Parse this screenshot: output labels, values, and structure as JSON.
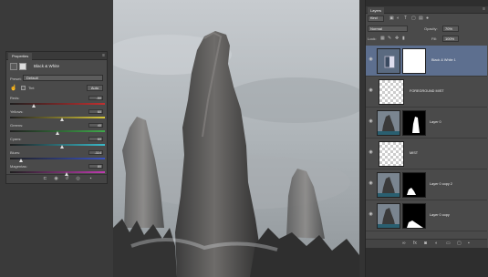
{
  "properties": {
    "tab": "Properties",
    "menu_icon": "panel-menu-icon",
    "title": "Black & White",
    "preset_label": "Preset:",
    "preset_value": "Default",
    "tint_label": "Tint",
    "auto_label": "Auto",
    "sliders": [
      {
        "label": "Reds:",
        "value": "-50",
        "fraction": 0.25,
        "colors": [
          "#1f1f1f",
          "#c03030"
        ]
      },
      {
        "label": "Yellows:",
        "value": "60",
        "fraction": 0.55,
        "colors": [
          "#1f1f1f",
          "#d8c83a"
        ]
      },
      {
        "label": "Greens:",
        "value": "40",
        "fraction": 0.5,
        "colors": [
          "#1f1f1f",
          "#3fa84a"
        ]
      },
      {
        "label": "Cyans:",
        "value": "60",
        "fraction": 0.55,
        "colors": [
          "#1f1f1f",
          "#3ab9c8"
        ]
      },
      {
        "label": "Blues:",
        "value": "-114",
        "fraction": 0.12,
        "colors": [
          "#1f1f1f",
          "#3a52c0"
        ]
      },
      {
        "label": "Magentas:",
        "value": "80",
        "fraction": 0.6,
        "colors": [
          "#1f1f1f",
          "#c03ab0"
        ]
      }
    ]
  },
  "layers": {
    "tab": "Layers",
    "filter_value": "Kind",
    "blend_mode": "Normal",
    "opacity_label": "Opacity:",
    "opacity_value": "70%",
    "lock_label": "Lock:",
    "fill_label": "Fill:",
    "fill_value": "100%",
    "items": [
      {
        "name": "Black & White 1",
        "kind": "adjustment",
        "selected": true
      },
      {
        "name": "FOREGROUND MIST",
        "kind": "transparent",
        "selected": false
      },
      {
        "name": "Layer 0",
        "kind": "photo-mask",
        "selected": false
      },
      {
        "name": "MIST",
        "kind": "transparent",
        "selected": false
      },
      {
        "name": "Layer 0 copy 2",
        "kind": "photo-mask2",
        "selected": false
      },
      {
        "name": "Layer 0 copy",
        "kind": "photo-mask3",
        "selected": false
      }
    ]
  },
  "colors": {
    "panel": "#4a4a4a",
    "selected_row": "#5d6f8f",
    "sky": "#b9bfc4"
  }
}
